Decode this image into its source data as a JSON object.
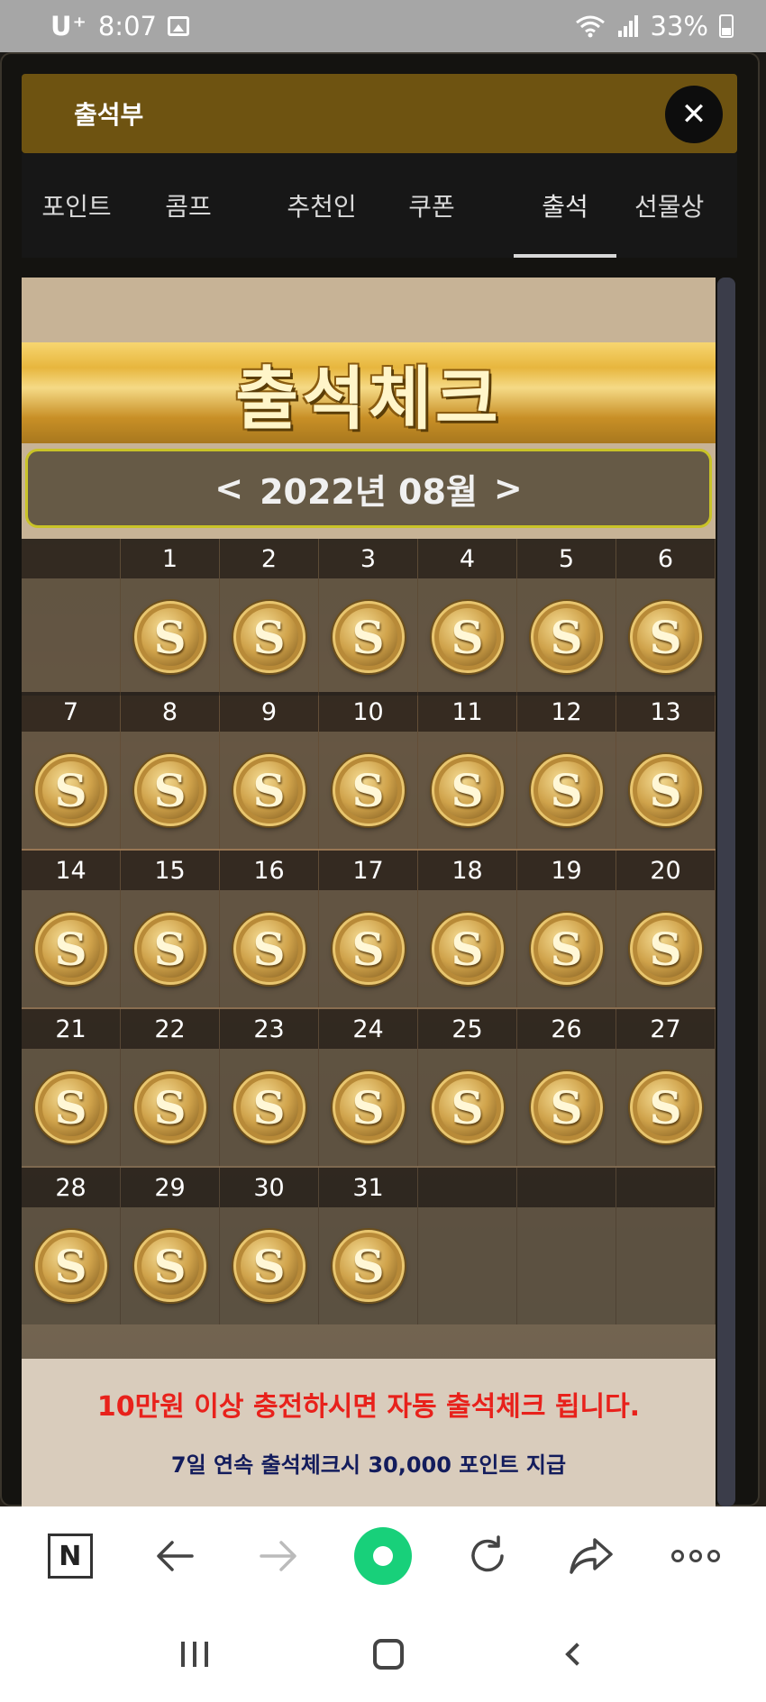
{
  "status_bar": {
    "carrier": "U⁺",
    "time": "8:07",
    "battery": "33%"
  },
  "popup": {
    "title": "출석부",
    "close_label": "✕"
  },
  "tabs": [
    {
      "label": "포인트",
      "active": false
    },
    {
      "label": "콤프",
      "active": false
    },
    {
      "label": "추천인",
      "active": false
    },
    {
      "label": "쿠폰",
      "active": false
    },
    {
      "label": "출석",
      "active": true
    },
    {
      "label": "선물상",
      "active": false
    }
  ],
  "banner": {
    "text": "출석체크"
  },
  "month_nav": {
    "prev": "<",
    "label": "2022년 08월",
    "next": ">"
  },
  "calendar": {
    "first_weekday_index": 1,
    "days_in_month": 31,
    "attended_days": [
      1,
      2,
      3,
      4,
      5,
      6,
      7,
      8,
      9,
      10,
      11,
      12,
      13,
      14,
      15,
      16,
      17,
      18,
      19,
      20,
      21,
      22,
      23,
      24,
      25,
      26,
      27,
      28,
      29,
      30,
      31
    ],
    "coin_symbol": "S"
  },
  "notice": {
    "primary": "10만원 이상 충전하시면 자동 출석체크 됩니다.",
    "secondary": "7일 연속 출석체크시 30,000 포인트 지급"
  },
  "toolbar": {
    "icons": [
      "naver-home-icon",
      "back-arrow-icon",
      "forward-arrow-icon",
      "green-action-icon",
      "reload-icon",
      "share-icon",
      "more-icon"
    ]
  },
  "colors": {
    "header_gold": "#6e5311",
    "notice_red": "#e8211b",
    "notice_blue": "#131c5c",
    "month_border": "#c9c327"
  }
}
